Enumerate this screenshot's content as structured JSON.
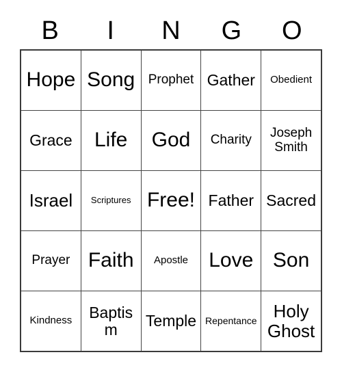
{
  "card": {
    "title": "Bingo Card",
    "header_letters": [
      "B",
      "I",
      "N",
      "G",
      "O"
    ],
    "background_color": "#ffffff",
    "border_color": "#444444",
    "text_color": "#000000",
    "rows": [
      [
        {
          "label": "Hope",
          "size": "fs-xxl"
        },
        {
          "label": "Song",
          "size": "fs-xxl"
        },
        {
          "label": "Prophet",
          "size": "fs-md"
        },
        {
          "label": "Gather",
          "size": "fs-lg"
        },
        {
          "label": "Obedient",
          "size": "fs-smp"
        }
      ],
      [
        {
          "label": "Grace",
          "size": "fs-lg"
        },
        {
          "label": "Life",
          "size": "fs-xxl"
        },
        {
          "label": "God",
          "size": "fs-xxl"
        },
        {
          "label": "Charity",
          "size": "fs-md"
        },
        {
          "label": "Joseph Smith",
          "size": "fs-md"
        }
      ],
      [
        {
          "label": "Israel",
          "size": "fs-xl"
        },
        {
          "label": "Scriptures",
          "size": "fs-xs"
        },
        {
          "label": "Free!",
          "size": "fs-xxl"
        },
        {
          "label": "Father",
          "size": "fs-lg"
        },
        {
          "label": "Sacred",
          "size": "fs-lg"
        }
      ],
      [
        {
          "label": "Prayer",
          "size": "fs-md"
        },
        {
          "label": "Faith",
          "size": "fs-xxl"
        },
        {
          "label": "Apostle",
          "size": "fs-smp"
        },
        {
          "label": "Love",
          "size": "fs-xxl"
        },
        {
          "label": "Son",
          "size": "fs-xxl"
        }
      ],
      [
        {
          "label": "Kindness",
          "size": "fs-smp"
        },
        {
          "label": "Baptism",
          "size": "fs-lg"
        },
        {
          "label": "Temple",
          "size": "fs-lg"
        },
        {
          "label": "Repentance",
          "size": "fs-sm"
        },
        {
          "label": "Holy Ghost",
          "size": "fs-xl"
        }
      ]
    ]
  }
}
